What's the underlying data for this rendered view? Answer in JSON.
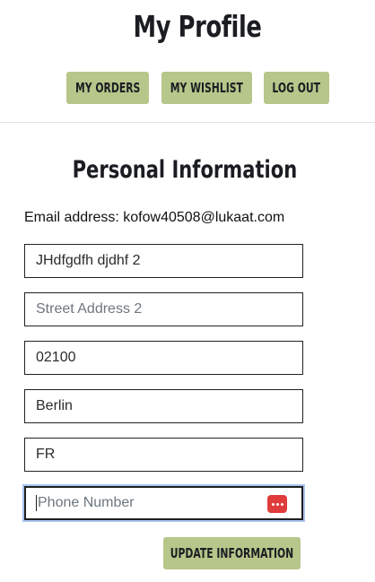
{
  "header": {
    "title": "My Profile"
  },
  "nav": {
    "orders_label": "MY ORDERS",
    "wishlist_label": "MY WISHLIST",
    "logout_label": "LOG OUT"
  },
  "personal": {
    "section_title": "Personal Information",
    "email_label": "Email address:",
    "email_value": "kofow40508@lukaat.com"
  },
  "form": {
    "address1_value": "JHdfgdfh djdhf 2",
    "address2_placeholder": "Street Address 2",
    "zip_value": "02100",
    "city_value": "Berlin",
    "country_value": "FR",
    "phone_placeholder": "Phone Number",
    "update_label": "UPDATE INFORMATION"
  },
  "icons": {
    "password_manager": "password-manager-icon"
  },
  "colors": {
    "button_bg": "#b7c68a",
    "focus_ring": "#a9c4ef",
    "password_icon": "#e03c3c"
  }
}
